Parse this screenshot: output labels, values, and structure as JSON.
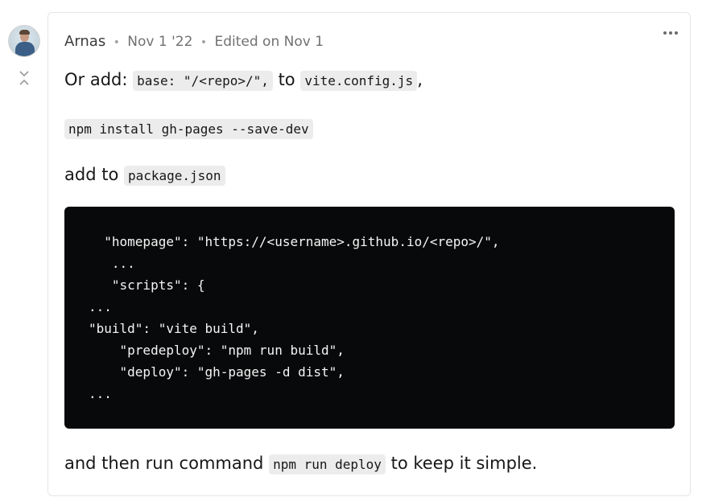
{
  "comment": {
    "author": "Arnas",
    "date": "Nov 1 '22",
    "edited": "Edited on Nov 1",
    "separator_dot": "•",
    "avatar_icon": "avatar",
    "collapse_icon": "collapse-chevrons-icon",
    "more_icon": "more-horizontal-icon"
  },
  "body": {
    "line1_prefix": "Or add: ",
    "line1_code1": "base: \"/<repo>/\",",
    "line1_mid": " to ",
    "line1_code2": "vite.config.js",
    "line1_suffix": ",",
    "install_code": "npm install gh-pages --save-dev",
    "add_prefix": "add to ",
    "add_code": "package.json",
    "code_block": "  \"homepage\": \"https://<username>.github.io/<repo>/\",\n   ...\n   \"scripts\": {\n...\n\"build\": \"vite build\",\n    \"predeploy\": \"npm run build\",\n    \"deploy\": \"gh-pages -d dist\",\n...",
    "final_prefix": "and then run command ",
    "final_code": "npm run deploy",
    "final_suffix": " to keep it simple."
  },
  "colors": {
    "code_block_bg": "#08090a",
    "inline_code_bg": "#ececec",
    "meta_text": "#717171"
  }
}
